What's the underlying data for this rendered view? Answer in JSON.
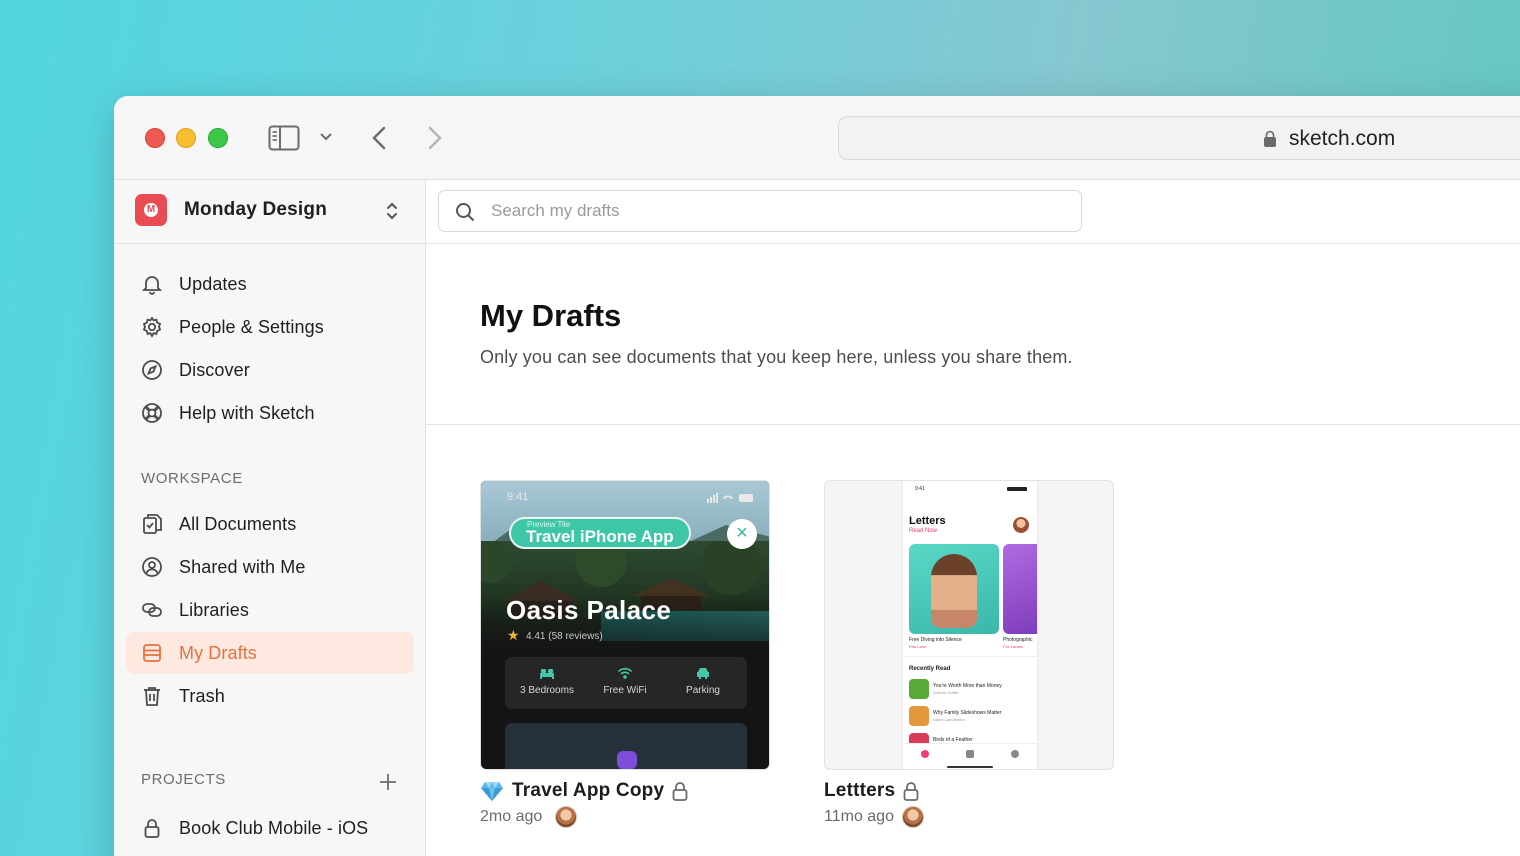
{
  "browser": {
    "url": "sketch.com"
  },
  "workspace": {
    "name": "Monday Design",
    "logo_text": "M"
  },
  "sidebar": {
    "top_items": [
      {
        "label": "Updates",
        "icon": "bell-icon"
      },
      {
        "label": "People & Settings",
        "icon": "gear-icon"
      },
      {
        "label": "Discover",
        "icon": "compass-icon"
      },
      {
        "label": "Help with Sketch",
        "icon": "lifebuoy-icon"
      }
    ],
    "workspace_label": "WORKSPACE",
    "workspace_items": [
      {
        "label": "All Documents",
        "icon": "documents-icon"
      },
      {
        "label": "Shared with Me",
        "icon": "person-circle-icon"
      },
      {
        "label": "Libraries",
        "icon": "libraries-icon"
      },
      {
        "label": "My Drafts",
        "icon": "drafts-icon",
        "active": true
      },
      {
        "label": "Trash",
        "icon": "trash-icon"
      }
    ],
    "projects_label": "PROJECTS",
    "projects": [
      {
        "label": "Book Club Mobile - iOS",
        "icon": "lock-icon"
      }
    ]
  },
  "search": {
    "placeholder": "Search my drafts",
    "value": ""
  },
  "main": {
    "title": "My Drafts",
    "subtitle": "Only you can see documents that you keep here, unless you share them."
  },
  "documents": [
    {
      "title": "Travel App Copy",
      "meta": "2mo ago",
      "badge_icon": "diamond-icon",
      "locked": true,
      "preview": {
        "status_time": "9:41",
        "pill_small": "Preview Tile",
        "pill_title": "Travel iPhone App",
        "close": "×",
        "hotel_name": "Oasis Palace",
        "star": "★",
        "rating": "4.41 (58 reviews)",
        "amenities": [
          {
            "label": "3 Bedrooms",
            "icon": "bed-icon"
          },
          {
            "label": "Free WiFi",
            "icon": "wifi-icon"
          },
          {
            "label": "Parking",
            "icon": "car-icon"
          }
        ]
      }
    },
    {
      "title": "Lettters",
      "meta": "11mo ago",
      "locked": true,
      "preview": {
        "status_time": "9:41",
        "app_title": "Letters",
        "app_sub": "Read Now",
        "card1_caption": "Free Diving into Silence",
        "card1_author": "Rita Lane",
        "card2_caption": "Photographic",
        "card2_author": "Fox Lambs",
        "recent_label": "Recently Read",
        "recent": [
          {
            "title": "You're Worth More than Money",
            "sub": "Antonio Hoffer",
            "color": "#5aa83a"
          },
          {
            "title": "Why Family Slideshows Matter",
            "sub": "Diane Lancaberro",
            "color": "#e5973b"
          },
          {
            "title": "Birds of a Feather",
            "sub": "",
            "color": "#d93b5a"
          }
        ]
      }
    }
  ],
  "colors": {
    "accent": "#e8713f",
    "active_bg": "#fde9df",
    "brand_red": "#e94b53"
  }
}
